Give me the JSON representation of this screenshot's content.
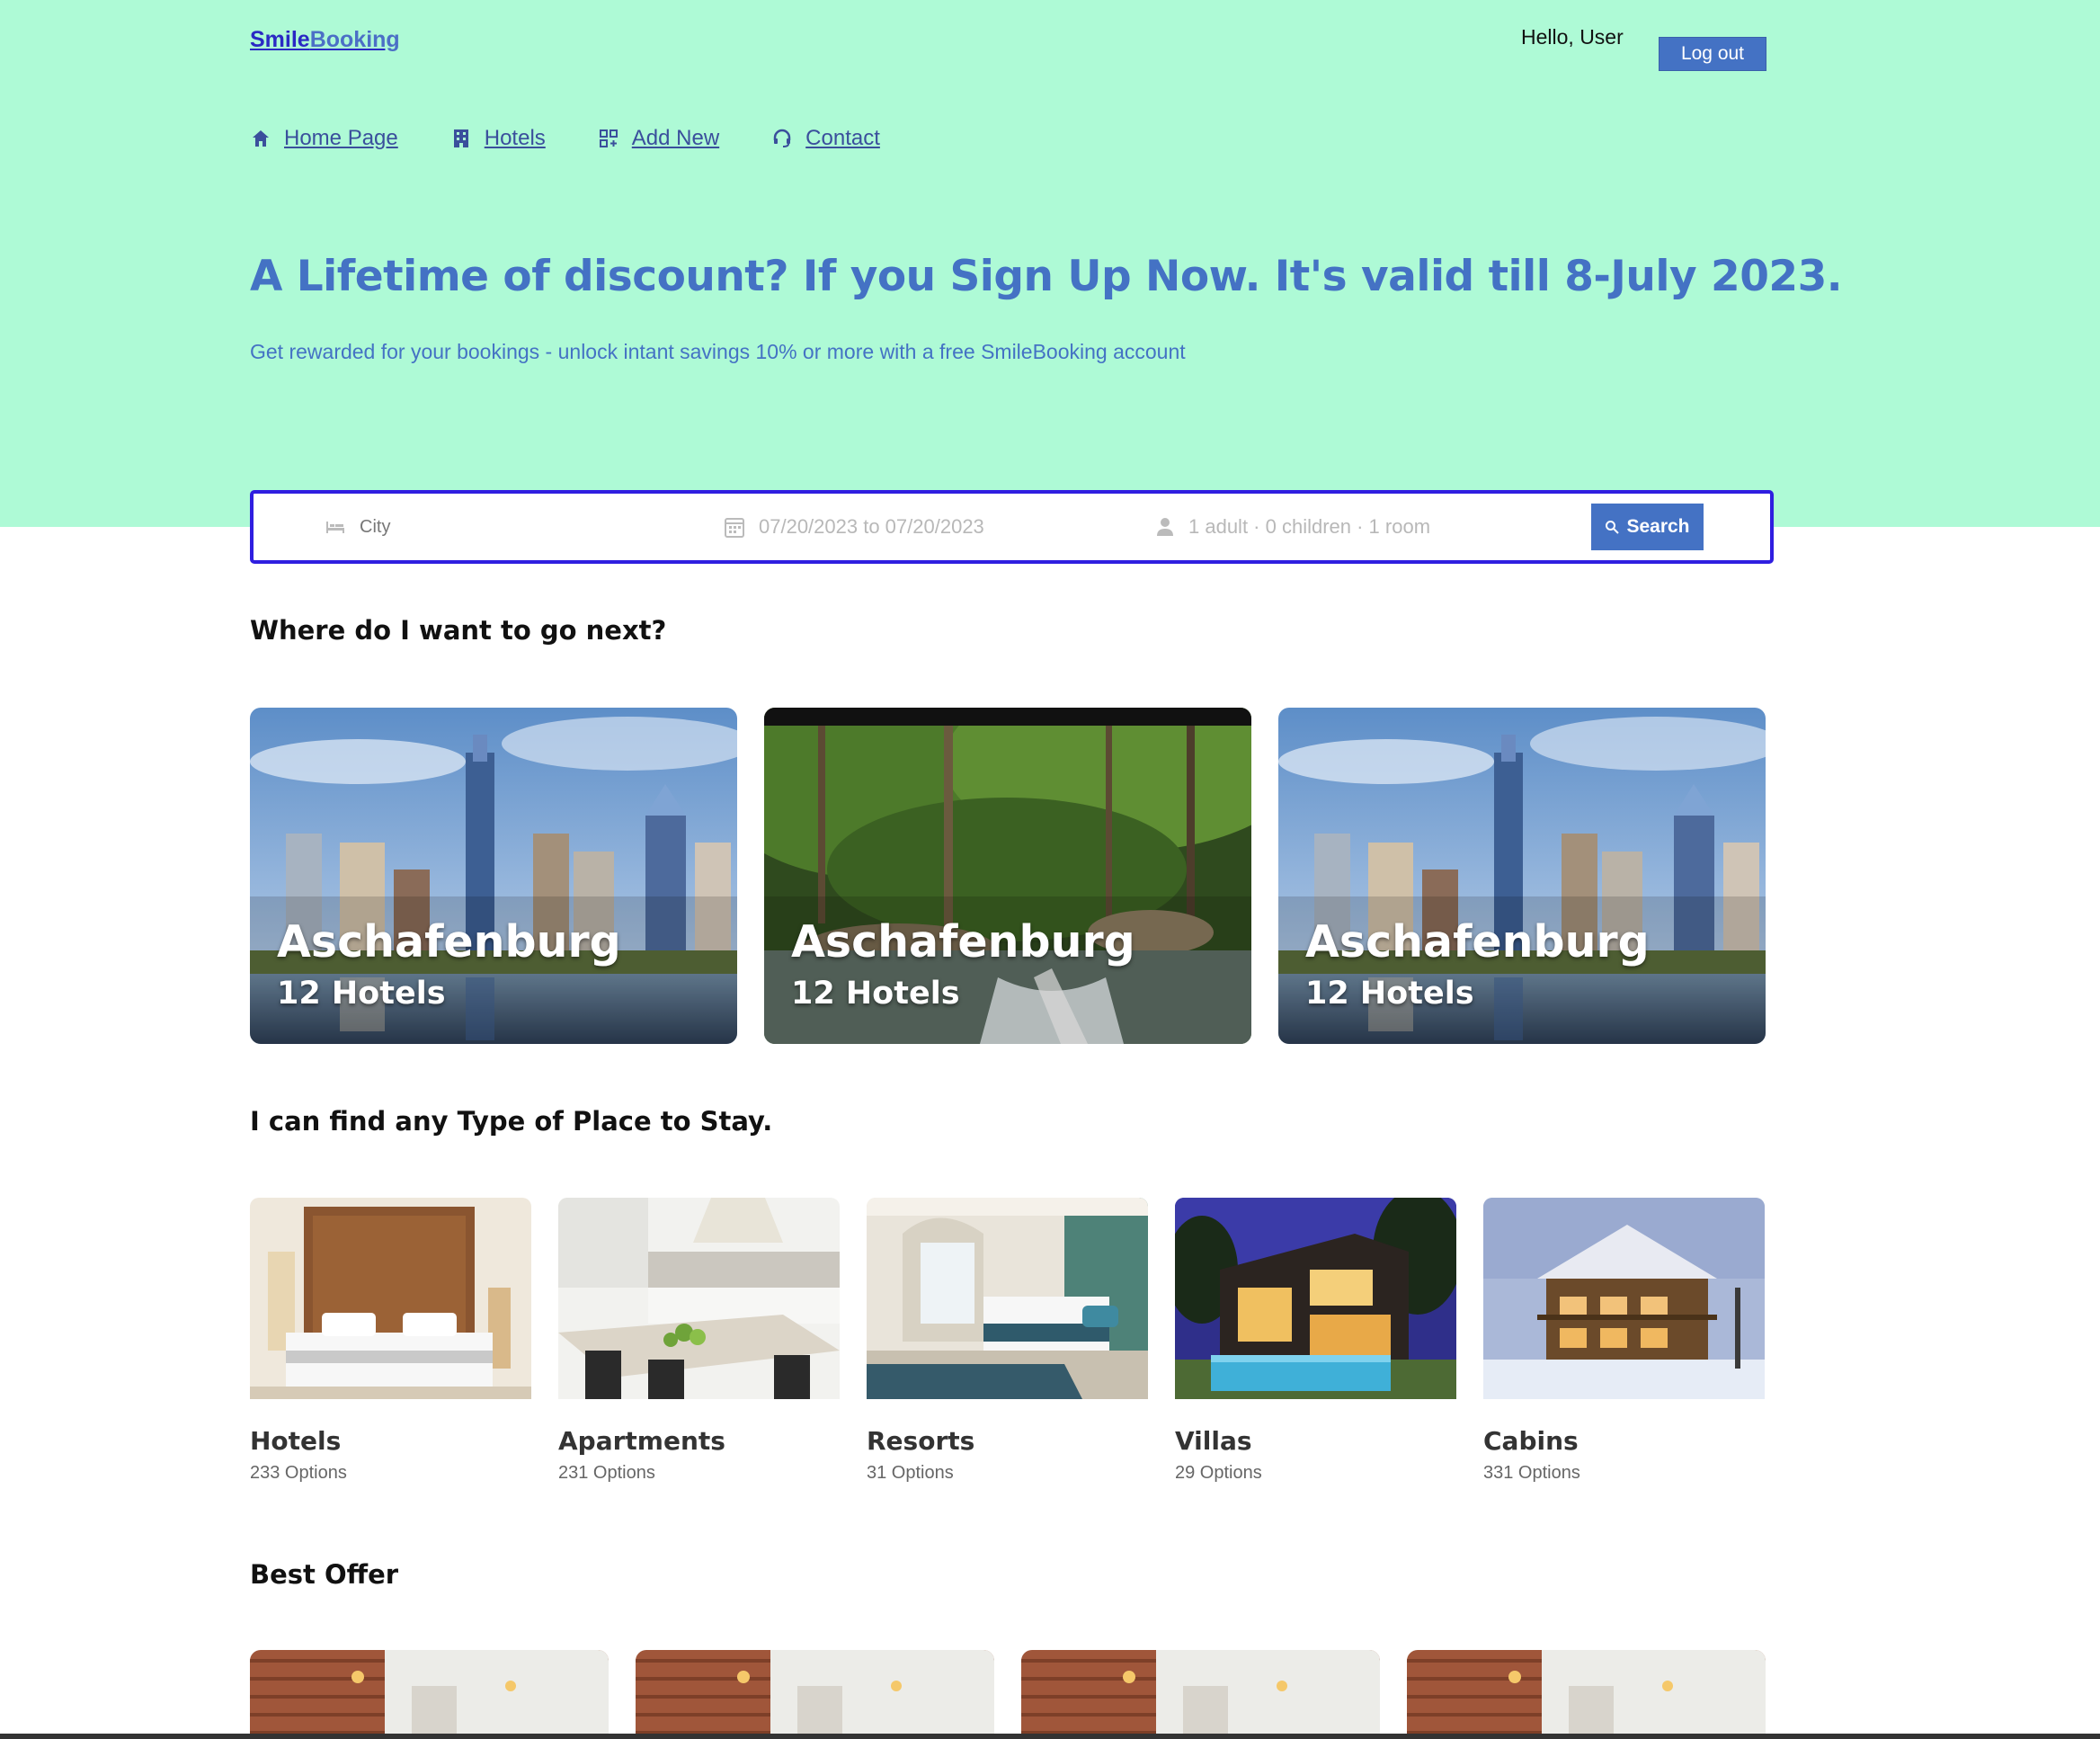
{
  "header": {
    "logo_part1": "Smile",
    "logo_part2": "Booking",
    "greeting": "Hello, User",
    "logout_label": "Log out"
  },
  "nav": {
    "items": [
      {
        "label": "Home Page",
        "icon": "home-icon"
      },
      {
        "label": "Hotels",
        "icon": "building-icon"
      },
      {
        "label": "Add New",
        "icon": "grid-icon"
      },
      {
        "label": "Contact",
        "icon": "headset-icon"
      }
    ]
  },
  "hero": {
    "headline": "A Lifetime of discount? If you Sign Up Now. It's valid till 8-July 2023.",
    "subline": "Get rewarded for your bookings - unlock intant savings 10% or more with a free SmileBooking account"
  },
  "search": {
    "city_placeholder": "City",
    "dates": "07/20/2023 to 07/20/2023",
    "guests": "1 adult · 0 children · 1 room",
    "button_label": "Search"
  },
  "destinations": {
    "title": "Where do I want to go next?",
    "items": [
      {
        "name": "Aschafenburg",
        "count": "12 Hotels",
        "image": "city-skyline"
      },
      {
        "name": "Aschafenburg",
        "count": "12 Hotels",
        "image": "forest-stream"
      },
      {
        "name": "Aschafenburg",
        "count": "12 Hotels",
        "image": "city-skyline"
      }
    ]
  },
  "property_types": {
    "title": "I can find any Type of Place to Stay.",
    "items": [
      {
        "name": "Hotels",
        "count": "233 Options"
      },
      {
        "name": "Apartments",
        "count": "231 Options"
      },
      {
        "name": "Resorts",
        "count": "31 Options"
      },
      {
        "name": "Villas",
        "count": "29 Options"
      },
      {
        "name": "Cabins",
        "count": "331 Options"
      }
    ]
  },
  "best_offer": {
    "title": "Best Offer"
  },
  "colors": {
    "hero_bg": "#aefad6",
    "accent": "#4472c4",
    "search_border": "#2f1ee0"
  }
}
